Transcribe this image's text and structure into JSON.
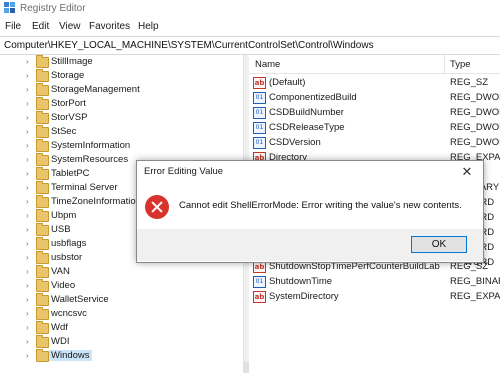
{
  "window": {
    "title": "Registry Editor"
  },
  "menu": [
    "File",
    "Edit",
    "View",
    "Favorites",
    "Help"
  ],
  "address": "Computer\\HKEY_LOCAL_MACHINE\\SYSTEM\\CurrentControlSet\\Control\\Windows",
  "tree": {
    "items": [
      {
        "label": "StillImage"
      },
      {
        "label": "Storage"
      },
      {
        "label": "StorageManagement"
      },
      {
        "label": "StorPort"
      },
      {
        "label": "StorVSP"
      },
      {
        "label": "StSec"
      },
      {
        "label": "SystemInformation"
      },
      {
        "label": "SystemResources"
      },
      {
        "label": "TabletPC"
      },
      {
        "label": "Terminal Server"
      },
      {
        "label": "TimeZoneInformation"
      },
      {
        "label": "Ubpm"
      },
      {
        "label": "USB"
      },
      {
        "label": "usbflags"
      },
      {
        "label": "usbstor"
      },
      {
        "label": "VAN"
      },
      {
        "label": "Video"
      },
      {
        "label": "WalletService"
      },
      {
        "label": "wcncsvc"
      },
      {
        "label": "Wdf"
      },
      {
        "label": "WDI"
      },
      {
        "label": "Windows"
      }
    ]
  },
  "values": {
    "headers": {
      "name": "Name",
      "type": "Type"
    },
    "rows": [
      {
        "name": "(Default)",
        "type": "REG_SZ",
        "icon": "string-value-icon"
      },
      {
        "name": "ComponentizedBuild",
        "type": "REG_DWORD",
        "icon": "binary-value-icon"
      },
      {
        "name": "CSDBuildNumber",
        "type": "REG_DWORD",
        "icon": "binary-value-icon"
      },
      {
        "name": "CSDReleaseType",
        "type": "REG_DWORD",
        "icon": "binary-value-icon"
      },
      {
        "name": "CSDVersion",
        "type": "REG_DWORD",
        "icon": "binary-value-icon"
      },
      {
        "name": "Directory",
        "type": "REG_EXPAND",
        "icon": "string-value-icon"
      },
      {
        "name": "",
        "type": "BINARY",
        "icon": ""
      },
      {
        "name": "",
        "type": "WORD",
        "icon": ""
      },
      {
        "name": "",
        "type": "WORD",
        "icon": ""
      },
      {
        "name": "",
        "type": "WORD",
        "icon": ""
      },
      {
        "name": "",
        "type": "WORD",
        "icon": ""
      },
      {
        "name": "",
        "type": "WORD",
        "icon": ""
      },
      {
        "name": "ShutdownStopTimePerfCounterBuildLab",
        "type": "REG_SZ",
        "icon": "string-value-icon"
      },
      {
        "name": "ShutdownTime",
        "type": "REG_BINARY",
        "icon": "binary-value-icon"
      },
      {
        "name": "SystemDirectory",
        "type": "REG_EXPAND",
        "icon": "string-value-icon"
      }
    ]
  },
  "dialog": {
    "title": "Error Editing Value",
    "message": "Cannot edit ShellErrorMode:  Error writing the value's new contents.",
    "ok_label": "OK",
    "close_glyph": "✕",
    "icon": "error-icon"
  },
  "colors": {
    "error_red": "#d9332d",
    "accent_blue": "#0078d7",
    "selection": "#cce4f7"
  }
}
